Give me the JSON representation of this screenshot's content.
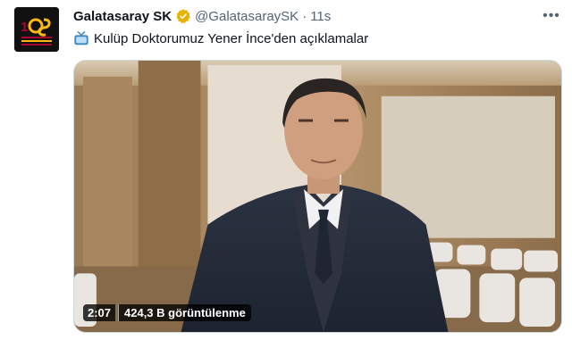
{
  "tweet": {
    "author_name": "Galatasaray SK",
    "handle": "@GalatasaraySK",
    "separator": "·",
    "time": "11s",
    "more_label": "•••",
    "text": "Kulüp Doktorumuz Yener İnce'den açıklamalar",
    "emoji": "tv-emoji"
  },
  "avatar": {
    "label": "GALATASARAY",
    "logo_text": "1905"
  },
  "video": {
    "duration": "2:07",
    "views": "424,3 B görüntülenme"
  },
  "colors": {
    "verified": "#e8b200",
    "secondary_text": "#536471",
    "primary_text": "#0f1419",
    "brand_red": "#a90432",
    "brand_yellow": "#fdb912"
  }
}
